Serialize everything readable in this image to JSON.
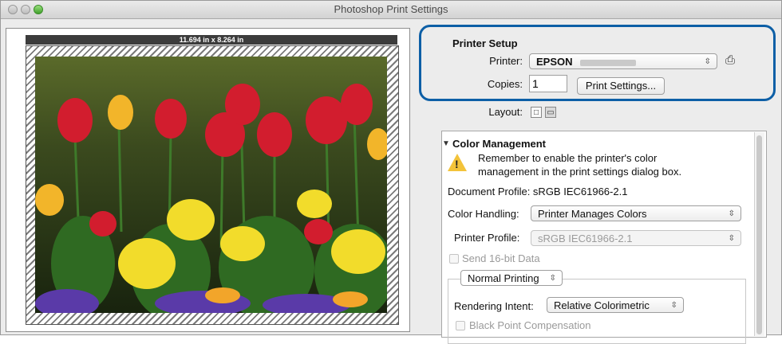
{
  "window": {
    "title": "Photoshop Print Settings"
  },
  "preview": {
    "dimensions": "11.694 in x 8.264 in"
  },
  "printer_setup": {
    "heading": "Printer Setup",
    "printer_label": "Printer:",
    "printer_value": "EPSON",
    "copies_label": "Copies:",
    "copies_value": "1",
    "print_settings_button": "Print Settings...",
    "layout_label": "Layout:"
  },
  "color_management": {
    "heading": "Color Management",
    "warning_line1": "Remember to enable the printer's color",
    "warning_line2": "management in the print settings dialog box.",
    "document_profile": "Document Profile: sRGB IEC61966-2.1",
    "color_handling_label": "Color Handling:",
    "color_handling_value": "Printer Manages Colors",
    "printer_profile_label": "Printer Profile:",
    "printer_profile_value": "sRGB IEC61966-2.1",
    "send16_label": "Send 16-bit Data",
    "normal_printing_value": "Normal Printing",
    "rendering_intent_label": "Rendering Intent:",
    "rendering_intent_value": "Relative Colorimetric",
    "black_point_label": "Black Point Compensation"
  },
  "colors": {
    "highlight": "#0d5fa6",
    "warning": "#f3c33a"
  }
}
